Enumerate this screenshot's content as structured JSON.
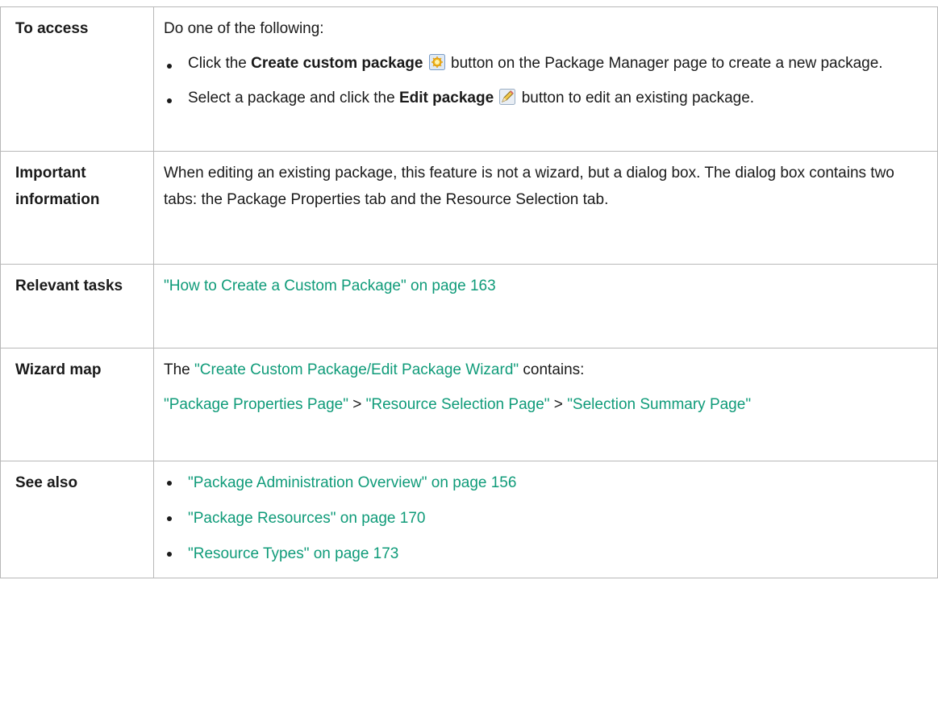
{
  "access": {
    "label": "To access",
    "intro": "Do one of the following:",
    "item1": {
      "pre": "Click the ",
      "bold": "Create custom package",
      "icon": "create-package-icon",
      "post": " button on the Package Manager page to create a new package."
    },
    "item2": {
      "pre": "Select a package and click the ",
      "bold": "Edit package",
      "icon": "edit-pencil-icon",
      "post": " button to edit an existing package."
    }
  },
  "important": {
    "label": "Important information",
    "text": "When editing an existing package, this feature is not a wizard, but a dialog box. The dialog box contains two tabs: the Package Properties tab and the Resource Selection tab."
  },
  "relevant": {
    "label": "Relevant tasks",
    "link": "\"How to Create a Custom Package\" on page 163"
  },
  "wizard": {
    "label": "Wizard map",
    "line1_pre": "The ",
    "line1_link": "\"Create Custom Package/Edit Package Wizard\"",
    "line1_post": " contains:",
    "link_a": "\"Package Properties Page\"",
    "sep1": " > ",
    "link_b": "\"Resource Selection Page\"",
    "sep2": " > ",
    "link_c": "\"Selection Summary Page\""
  },
  "see_also": {
    "label": "See also",
    "links": [
      "\"Package Administration Overview\" on page 156",
      "\"Package Resources\" on page 170",
      "\"Resource Types\" on page 173"
    ]
  },
  "colors": {
    "link": "#0f9b79",
    "border": "#b8b8b8",
    "text": "#1a1a1a"
  }
}
